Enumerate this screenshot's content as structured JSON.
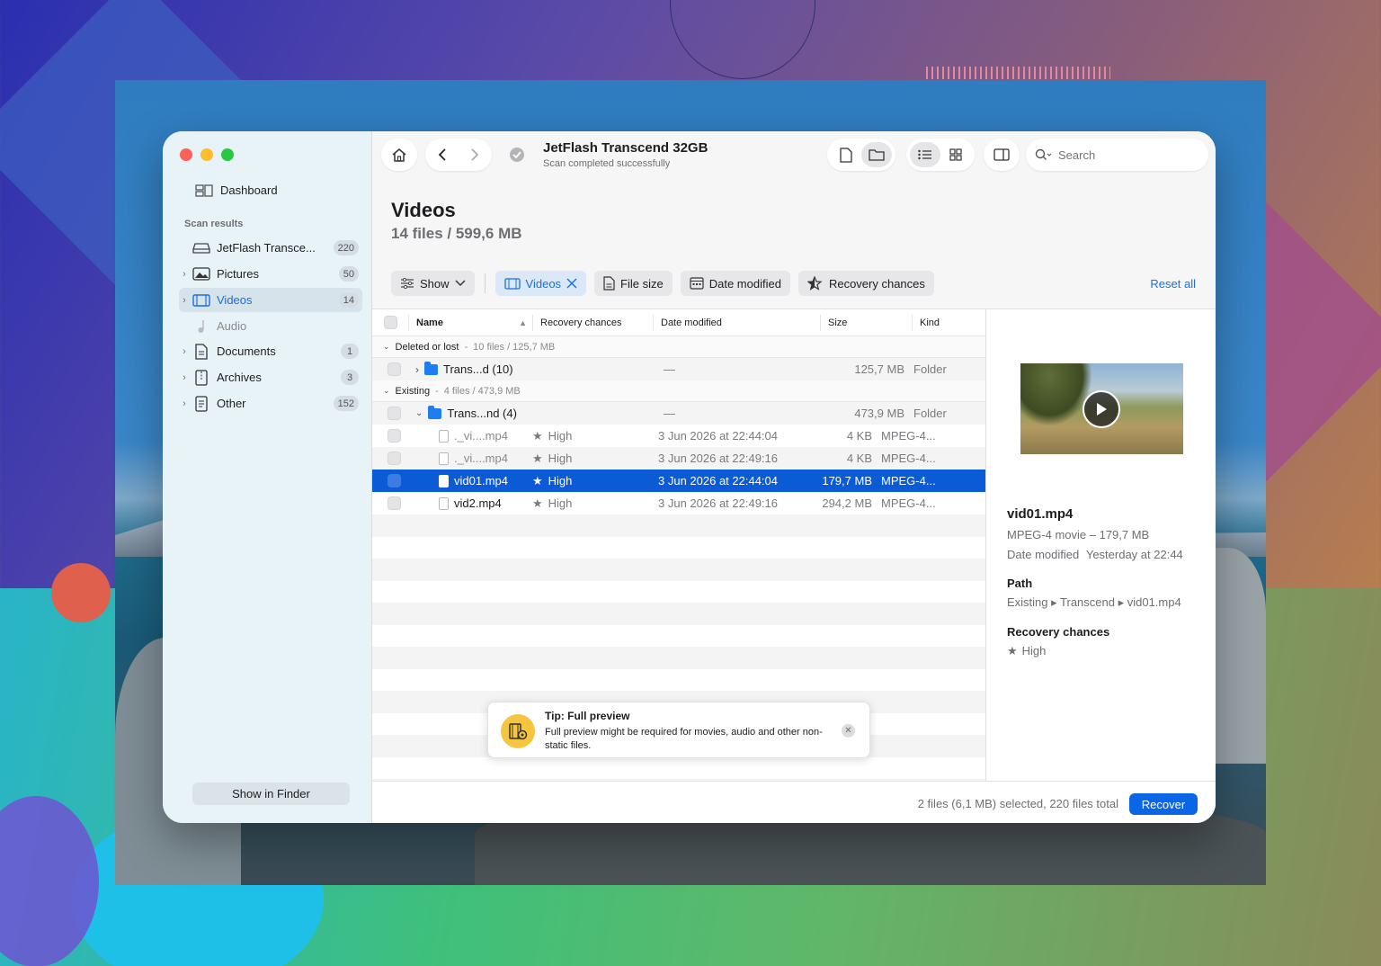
{
  "window": {
    "device_title": "JetFlash Transcend 32GB",
    "device_subtitle": "Scan completed successfully"
  },
  "sidebar": {
    "dashboard_label": "Dashboard",
    "section_label": "Scan results",
    "items": [
      {
        "label": "JetFlash Transce...",
        "count": "220",
        "icon": "drive-icon"
      },
      {
        "label": "Pictures",
        "count": "50",
        "icon": "picture-icon"
      },
      {
        "label": "Videos",
        "count": "14",
        "icon": "film-icon"
      },
      {
        "label": "Audio",
        "count": "",
        "icon": "music-note-icon"
      },
      {
        "label": "Documents",
        "count": "1",
        "icon": "document-icon"
      },
      {
        "label": "Archives",
        "count": "3",
        "icon": "archive-icon"
      },
      {
        "label": "Other",
        "count": "152",
        "icon": "other-file-icon"
      }
    ],
    "show_in_finder": "Show in Finder"
  },
  "search": {
    "placeholder": "Search"
  },
  "content": {
    "title": "Videos",
    "subtitle": "14 files / 599,6 MB"
  },
  "filters": {
    "show": "Show",
    "videos": "Videos",
    "file_size": "File size",
    "date_modified": "Date modified",
    "recovery_chances": "Recovery chances",
    "reset_all": "Reset all"
  },
  "table": {
    "columns": [
      "Name",
      "Recovery chances",
      "Date modified",
      "Size",
      "Kind"
    ],
    "groups": [
      {
        "label": "Deleted or lost",
        "summary": "10 files / 125,7 MB",
        "rows": [
          {
            "name": "Trans...d (10)",
            "recovery": "",
            "date": "—",
            "size": "125,7 MB",
            "kind": "Folder",
            "type": "folder"
          }
        ]
      },
      {
        "label": "Existing",
        "summary": "4 files / 473,9 MB",
        "rows": [
          {
            "name": "Trans...nd (4)",
            "recovery": "",
            "date": "—",
            "size": "473,9 MB",
            "kind": "Folder",
            "type": "folder"
          },
          {
            "name": "._vi....mp4",
            "recovery": "High",
            "date": "3 Jun 2026 at 22:44:04",
            "size": "4 KB",
            "kind": "MPEG-4...",
            "type": "file"
          },
          {
            "name": "._vi....mp4",
            "recovery": "High",
            "date": "3 Jun 2026 at 22:49:16",
            "size": "4 KB",
            "kind": "MPEG-4...",
            "type": "file"
          },
          {
            "name": "vid01.mp4",
            "recovery": "High",
            "date": "3 Jun 2026 at 22:44:04",
            "size": "179,7 MB",
            "kind": "MPEG-4...",
            "type": "file",
            "selected": true
          },
          {
            "name": "vid2.mp4",
            "recovery": "High",
            "date": "3 Jun 2026 at 22:49:16",
            "size": "294,2 MB",
            "kind": "MPEG-4...",
            "type": "file"
          }
        ]
      }
    ]
  },
  "tip": {
    "title": "Tip: Full preview",
    "body": "Full preview might be required for movies, audio and other non-static files."
  },
  "details": {
    "filename": "vid01.mp4",
    "type_size": "MPEG-4 movie – 179,7 MB",
    "date_label": "Date modified",
    "date_value": "Yesterday at 22:44",
    "path_label": "Path",
    "path_value": "Existing ▸ Transcend ▸ vid01.mp4",
    "recovery_label": "Recovery chances",
    "recovery_value": "High"
  },
  "status": {
    "summary": "2 files (6,1 MB) selected, 220 files total",
    "recover": "Recover"
  },
  "colors": {
    "accent": "#0a66e4",
    "selection": "#0b5ad6",
    "folder": "#1e7ef0",
    "tip_icon": "#f5c542"
  }
}
